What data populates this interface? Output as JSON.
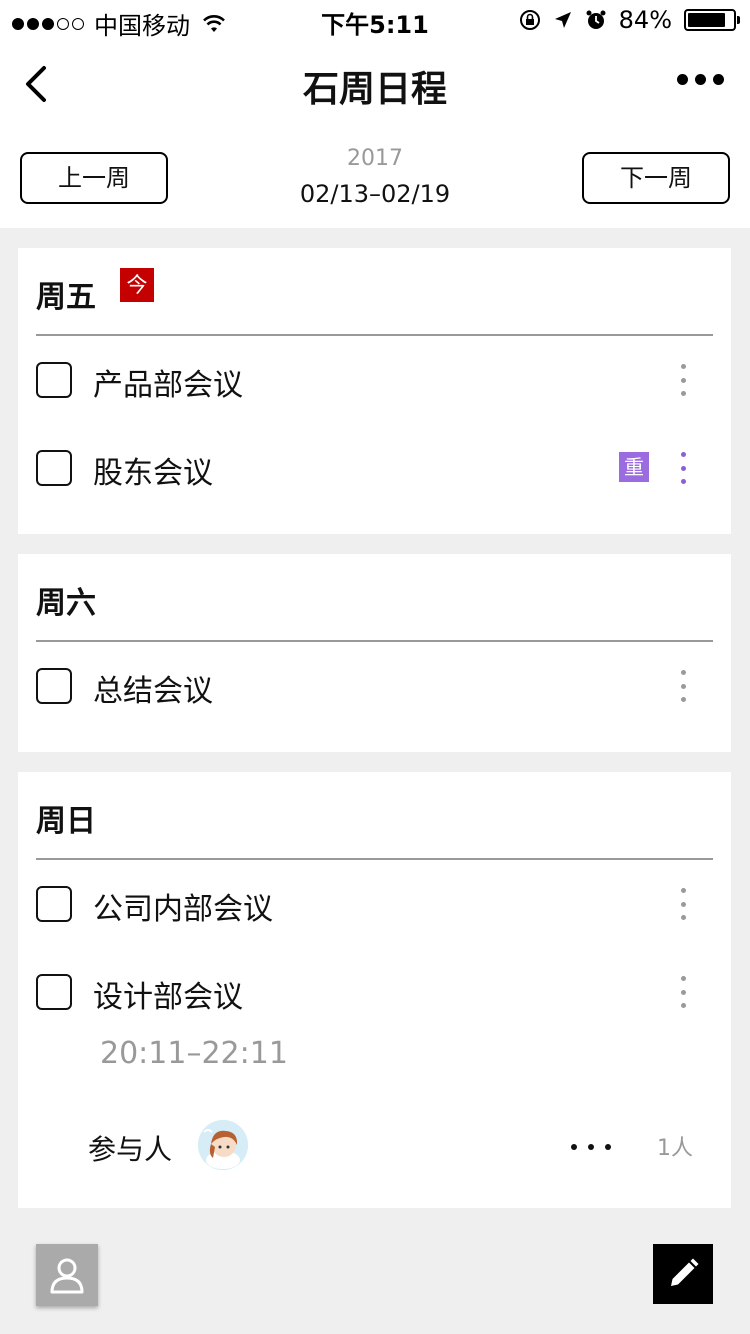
{
  "status_bar": {
    "carrier": "中国移动",
    "time": "下午5:11",
    "battery_text": "84%",
    "battery_level": 0.84,
    "signal_bars_filled": 3,
    "signal_bars_total": 5
  },
  "nav": {
    "title": "石周日程"
  },
  "week": {
    "prev_label": "上一周",
    "next_label": "下一周",
    "year": "2017",
    "range": "02/13–02/19"
  },
  "days": [
    {
      "title": "周五",
      "today_badge": "今",
      "tasks": [
        {
          "title": "产品部会议"
        },
        {
          "title": "股东会议",
          "badge": "重"
        }
      ]
    },
    {
      "title": "周六",
      "tasks": [
        {
          "title": "总结会议"
        }
      ]
    },
    {
      "title": "周日",
      "tasks": [
        {
          "title": "公司内部会议"
        },
        {
          "title": "设计部会议",
          "time": "20:11–22:11"
        }
      ],
      "participants": {
        "label": "参与人",
        "count": "1人"
      }
    }
  ],
  "colors": {
    "today_badge": "#c40000",
    "priority_badge": "#9b6be0",
    "background": "#efefef"
  }
}
